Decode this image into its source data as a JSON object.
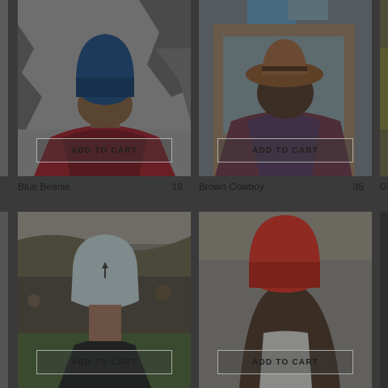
{
  "products": [
    {
      "name": "Blue Beanie",
      "price": "18",
      "cart_label": "ADD TO CART",
      "hat_color": "#1d3a5a"
    },
    {
      "name": "Brown Cowboy",
      "price": "35",
      "cart_label": "ADD TO CART",
      "hat_color": "#6b4a34"
    },
    {
      "name": "Gr",
      "price": "",
      "cart_label": ""
    },
    {
      "name": "",
      "price": "",
      "cart_label": "ADD TO CART",
      "hat_color": "#7f8a8c"
    },
    {
      "name": "",
      "price": "",
      "cart_label": "ADD TO CART",
      "hat_color": "#8e2a22"
    }
  ],
  "colors": {
    "backdrop": "#3a3a3a",
    "caption_text": "#1d1d1d",
    "button_border": "#cdcdcd"
  },
  "icons": [
    "palm-tree-logo-icon"
  ]
}
